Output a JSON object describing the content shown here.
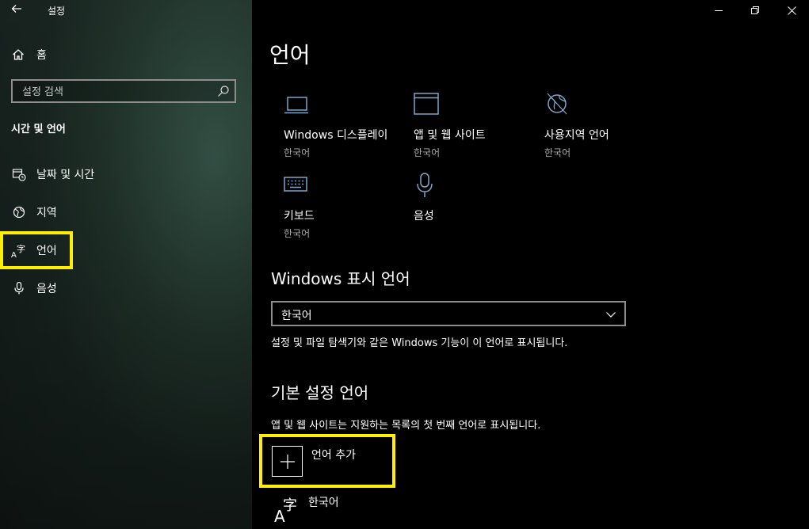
{
  "window": {
    "title": "설정"
  },
  "sidebar": {
    "home_label": "홈",
    "search_placeholder": "설정 검색",
    "section_title": "시간 및 언어",
    "items": [
      {
        "label": "날짜 및 시간",
        "icon": "clock-calendar-icon"
      },
      {
        "label": "지역",
        "icon": "globe-region-icon"
      },
      {
        "label": "언어",
        "icon": "language-icon",
        "selected": true
      },
      {
        "label": "음성",
        "icon": "microphone-icon"
      }
    ]
  },
  "main": {
    "title": "언어",
    "tiles": [
      {
        "name": "Windows 디스플레이",
        "sub": "한국어",
        "icon": "laptop-icon"
      },
      {
        "name": "앱 및 웹 사이트",
        "sub": "한국어",
        "icon": "browser-window-icon"
      },
      {
        "name": "사용지역 언어",
        "sub": "한국어",
        "icon": "globe-icon"
      },
      {
        "name": "키보드",
        "sub": "한국어",
        "icon": "keyboard-icon"
      },
      {
        "name": "음성",
        "sub": "",
        "icon": "microphone-icon"
      }
    ],
    "display_language": {
      "heading": "Windows 표시 언어",
      "selected": "한국어",
      "description": "설정 및 파일 탐색기와 같은 Windows 기능이 이 언어로 표시됩니다."
    },
    "preferred_languages": {
      "heading": "기본 설정 언어",
      "description": "앱 및 웹 사이트는 지원하는 목록의 첫 번째 언어로 표시됩니다.",
      "add_label": "언어 추가",
      "languages": [
        {
          "name": "한국어"
        }
      ]
    }
  },
  "colors": {
    "highlight": "#ffee00",
    "background": "#000000"
  }
}
